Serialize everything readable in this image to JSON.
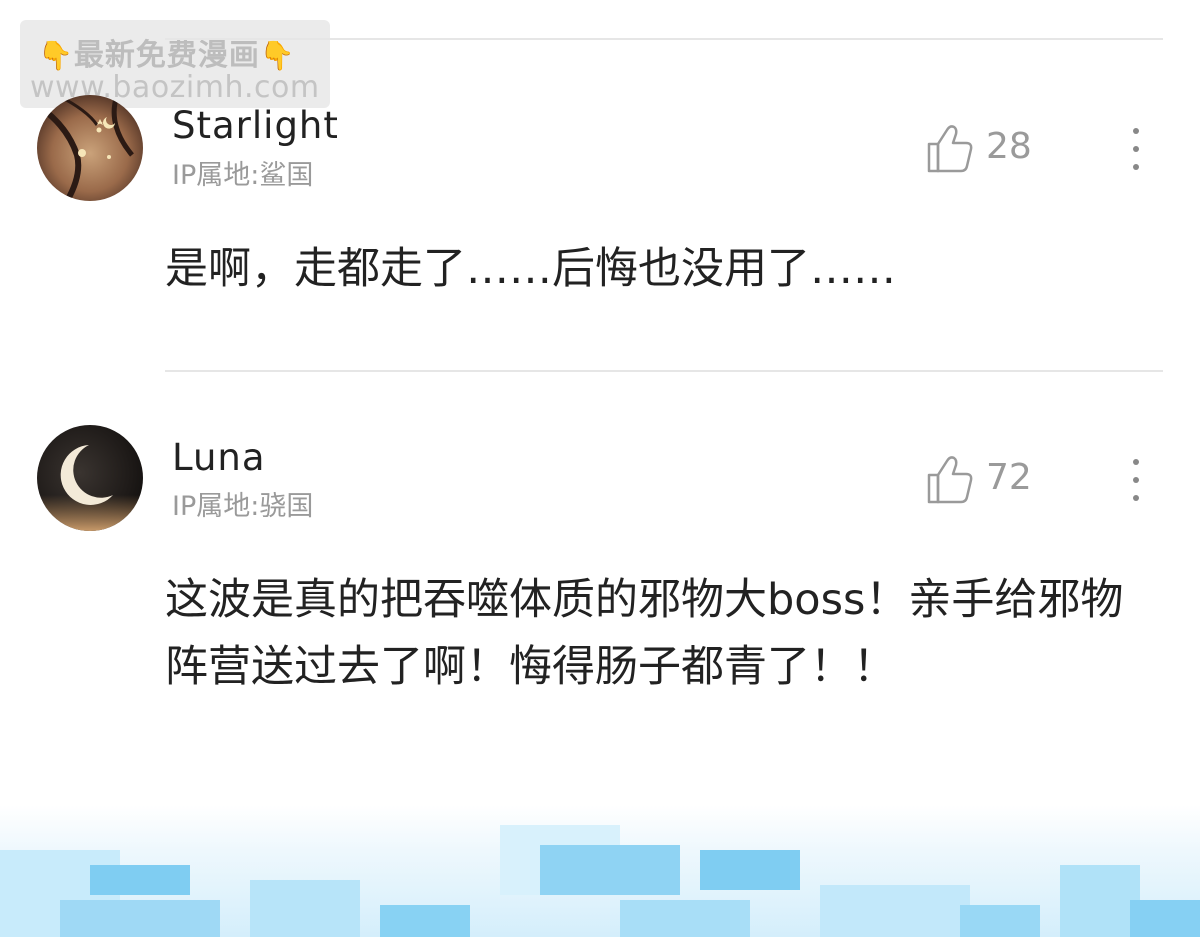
{
  "watermark": {
    "line1": "最新免费漫画",
    "line2": "www.baozimh.com",
    "finger_icon": "pointing-down-hand"
  },
  "comments": [
    {
      "username": "Starlight",
      "ip": "IP属地:鲨国",
      "likes": "28",
      "text": "是啊，走都走了……后悔也没用了……",
      "avatar_icon": "starry-dark-avatar"
    },
    {
      "username": "Luna",
      "ip": "IP属地:骁国",
      "likes": "72",
      "text": "这波是真的把吞噬体质的邪物大boss！亲手给邪物阵营送过去了啊！悔得肠子都青了！！",
      "avatar_icon": "crescent-moon-avatar"
    }
  ],
  "colors": {
    "text": "#222222",
    "secondary": "#9a9a9a",
    "divider": "#e6e6e6",
    "footer_tile": "#aee2f8"
  }
}
